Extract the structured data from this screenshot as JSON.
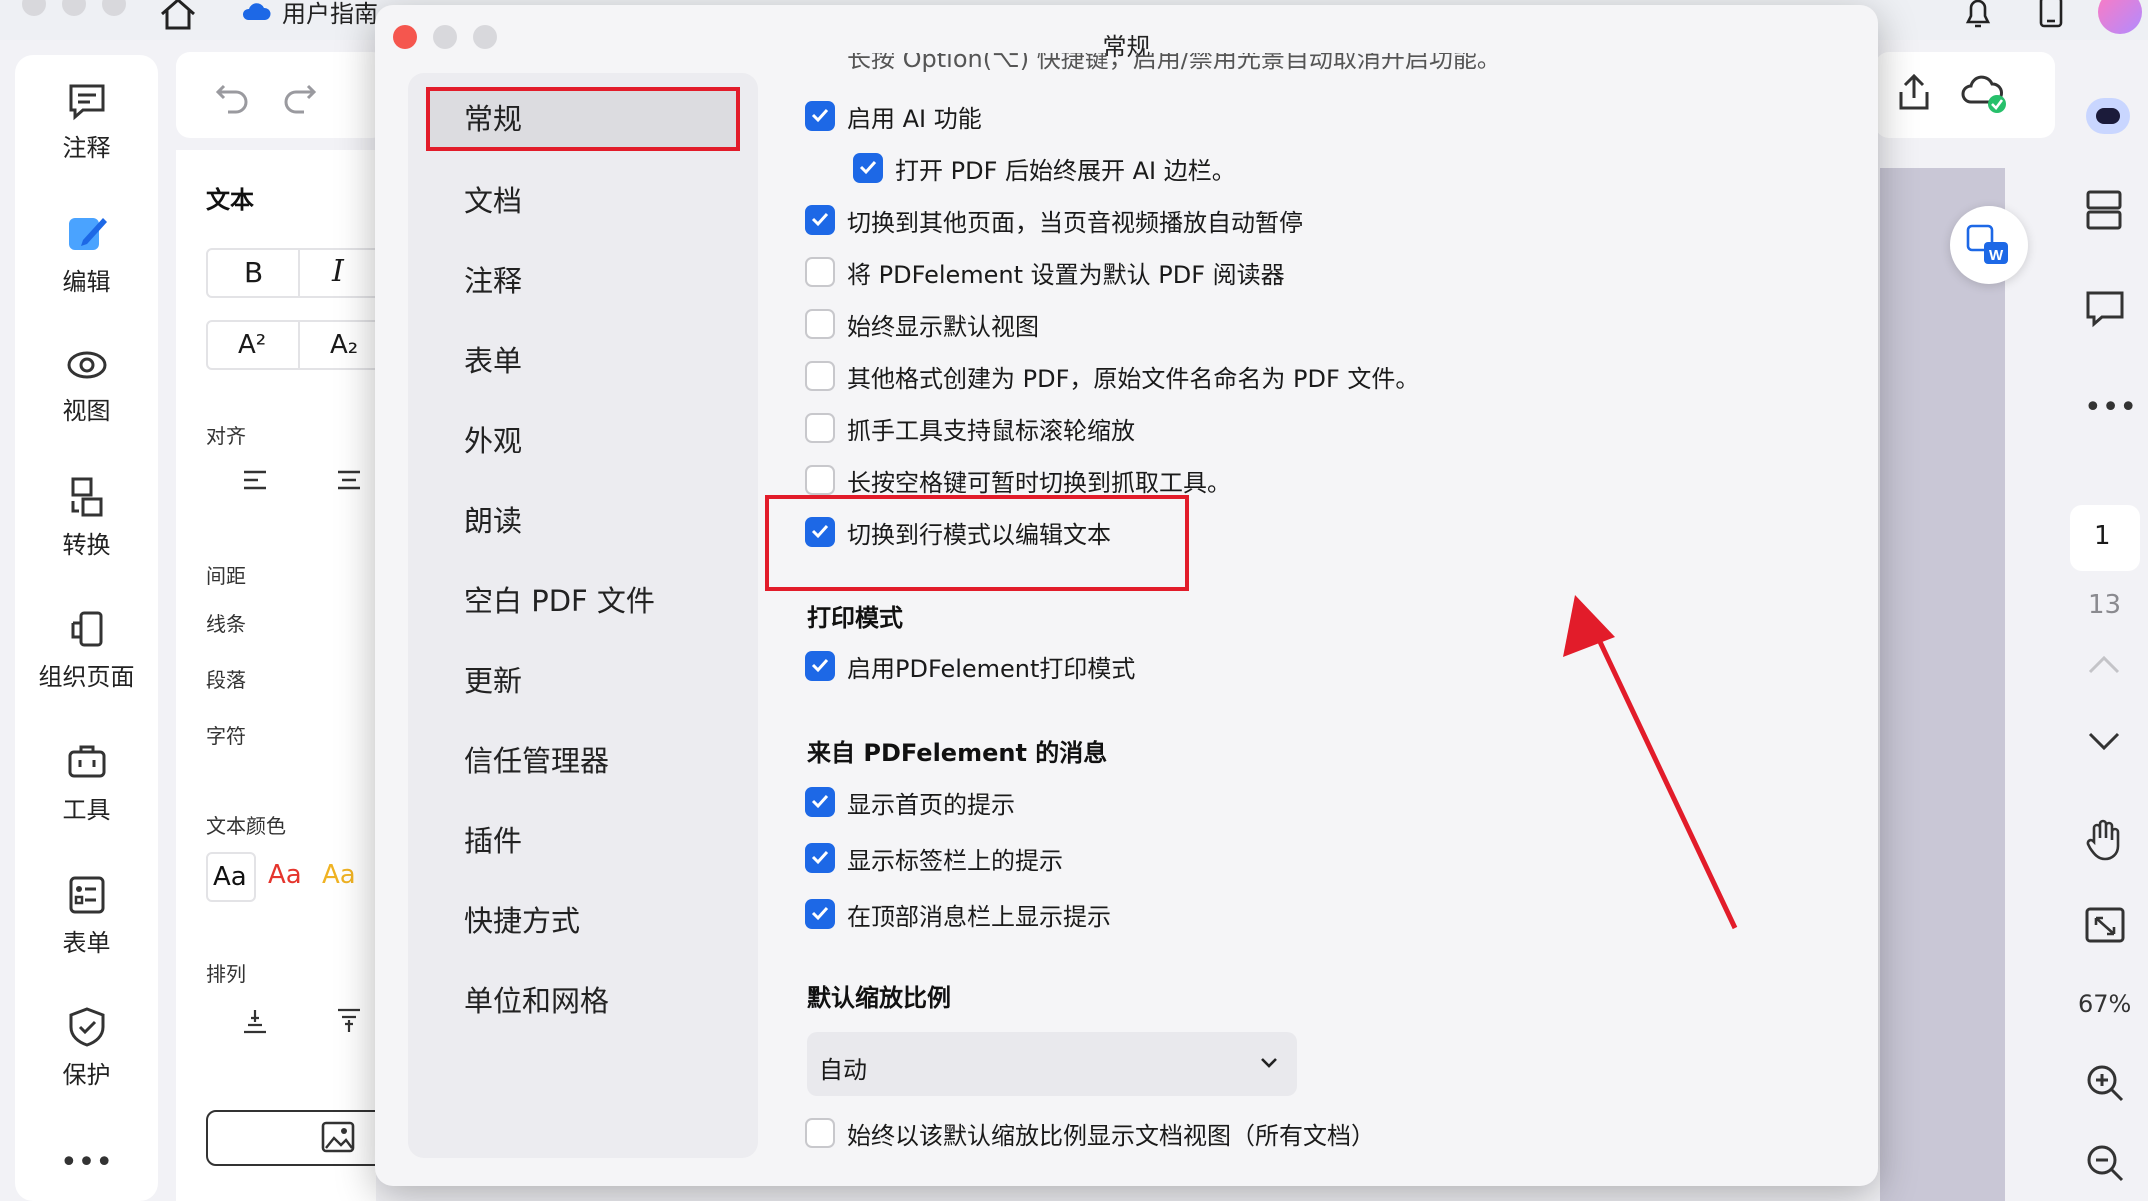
{
  "topbar": {
    "tab_label": "用户指南"
  },
  "left_rail": {
    "items": [
      {
        "label": "注释",
        "icon": "comment-icon"
      },
      {
        "label": "编辑",
        "icon": "edit-icon"
      },
      {
        "label": "视图",
        "icon": "eye-icon"
      },
      {
        "label": "转换",
        "icon": "convert-icon"
      },
      {
        "label": "组织页面",
        "icon": "organize-pages-icon"
      },
      {
        "label": "工具",
        "icon": "toolbox-icon"
      },
      {
        "label": "表单",
        "icon": "form-icon"
      },
      {
        "label": "保护",
        "icon": "shield-icon"
      }
    ],
    "more": "•••"
  },
  "edit_panel": {
    "title": "文本",
    "bold": "B",
    "italic": "I",
    "superscript": "A²",
    "subscript": "A₂",
    "align_label": "对齐",
    "spacing_label": "间距",
    "line_label": "线条",
    "paragraph_label": "段落",
    "char_label": "字符",
    "text_color_label": "文本颜色",
    "color_samples": [
      "Aa",
      "Aa",
      "Aa"
    ],
    "arrange_label": "排列"
  },
  "right_rail": {
    "page_current": "1",
    "page_total": "13",
    "zoom": "67%"
  },
  "dialog": {
    "title": "常规",
    "nav": [
      "常规",
      "文档",
      "注释",
      "表单",
      "外观",
      "朗读",
      "空白 PDF 文件",
      "更新",
      "信任管理器",
      "插件",
      "快捷方式",
      "单位和网格"
    ],
    "selected_nav": "常规",
    "clipped_top_text": "长按 Option(⌥) 快捷键，启用/禁用光景自动取消开启功能。",
    "options": [
      {
        "label": "启用 AI 功能",
        "checked": true
      },
      {
        "label": "打开 PDF 后始终展开 AI 边栏。",
        "checked": true
      },
      {
        "label": "切换到其他页面，当页音视频播放自动暂停",
        "checked": true
      },
      {
        "label": "将 PDFelement 设置为默认 PDF 阅读器",
        "checked": false
      },
      {
        "label": "始终显示默认视图",
        "checked": false
      },
      {
        "label": "其他格式创建为 PDF，原始文件名命名为 PDF 文件。",
        "checked": false
      },
      {
        "label": "抓手工具支持鼠标滚轮缩放",
        "checked": false
      },
      {
        "label": "长按空格键可暂时切换到抓取工具。",
        "checked": false
      },
      {
        "label": "切换到行模式以编辑文本",
        "checked": true
      }
    ],
    "print_section": {
      "title": "打印模式",
      "option": {
        "label": "启用PDFelement打印模式",
        "checked": true
      }
    },
    "messages_section": {
      "title": "来自 PDFelement 的消息",
      "options": [
        {
          "label": "显示首页的提示",
          "checked": true
        },
        {
          "label": "显示标签栏上的提示",
          "checked": true
        },
        {
          "label": "在顶部消息栏上显示提示",
          "checked": true
        }
      ]
    },
    "zoom_section": {
      "title": "默认缩放比例",
      "select_value": "自动",
      "option": {
        "label": "始终以该默认缩放比例显示文档视图（所有文档）",
        "checked": false
      }
    }
  },
  "colors": {
    "accent": "#1d68e6",
    "highlight": "#e21c2a"
  }
}
